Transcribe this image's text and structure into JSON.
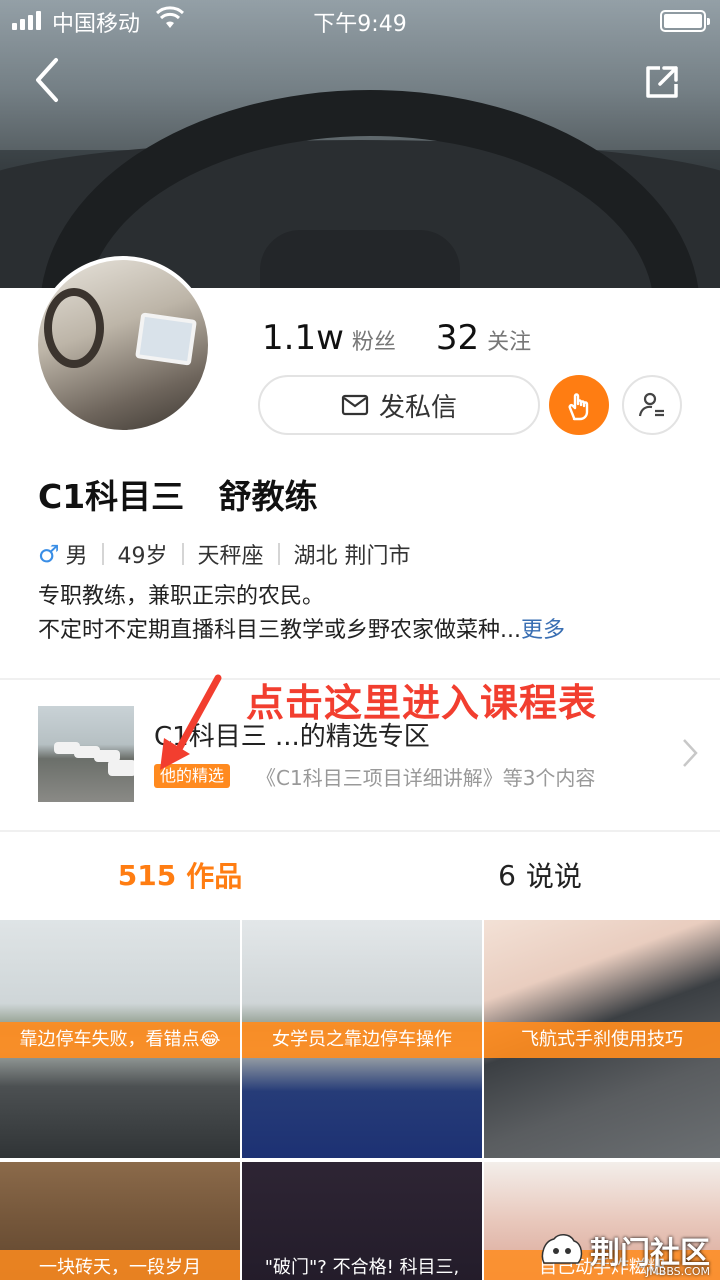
{
  "status_bar": {
    "carrier": "中国移动",
    "time": "下午9:49"
  },
  "profile": {
    "followers_count": "1.1w",
    "followers_label": "粉丝",
    "following_count": "32",
    "following_label": "关注",
    "message_button": "发私信",
    "name": "C1科目三   舒教练",
    "gender": "男",
    "age": "49岁",
    "zodiac": "天秤座",
    "location": "湖北 荆门市",
    "bio_line1": "专职教练，兼职正宗的农民。",
    "bio_line2": "不定时不定期直播科目三教学或乡野农家做菜种...",
    "bio_more": "更多"
  },
  "feature": {
    "title": "C1科目三 ...的精选专区",
    "tag": "他的精选",
    "desc": "《C1科目三项目详细讲解》等3个内容"
  },
  "annotation": "点击这里进入课程表",
  "tabs": [
    {
      "count": "515",
      "label": "作品"
    },
    {
      "count": "6",
      "label": "说说"
    }
  ],
  "videos": [
    {
      "caption": "靠边停车失败，看错点😂"
    },
    {
      "caption": "女学员之靠边停车操作"
    },
    {
      "caption": "飞航式手刹使用技巧"
    },
    {
      "caption": "一块砖天，一段岁月"
    },
    {
      "caption": "\"破门\"? 不合格! 科目三,"
    },
    {
      "caption": "自己动手炸糍粑"
    }
  ],
  "watermark": {
    "text": "荆门社区",
    "sub": "JMBBS.COM"
  },
  "colors": {
    "accent": "#ff7d12",
    "annotation": "#f23e2f",
    "link": "#3a6fb3"
  }
}
